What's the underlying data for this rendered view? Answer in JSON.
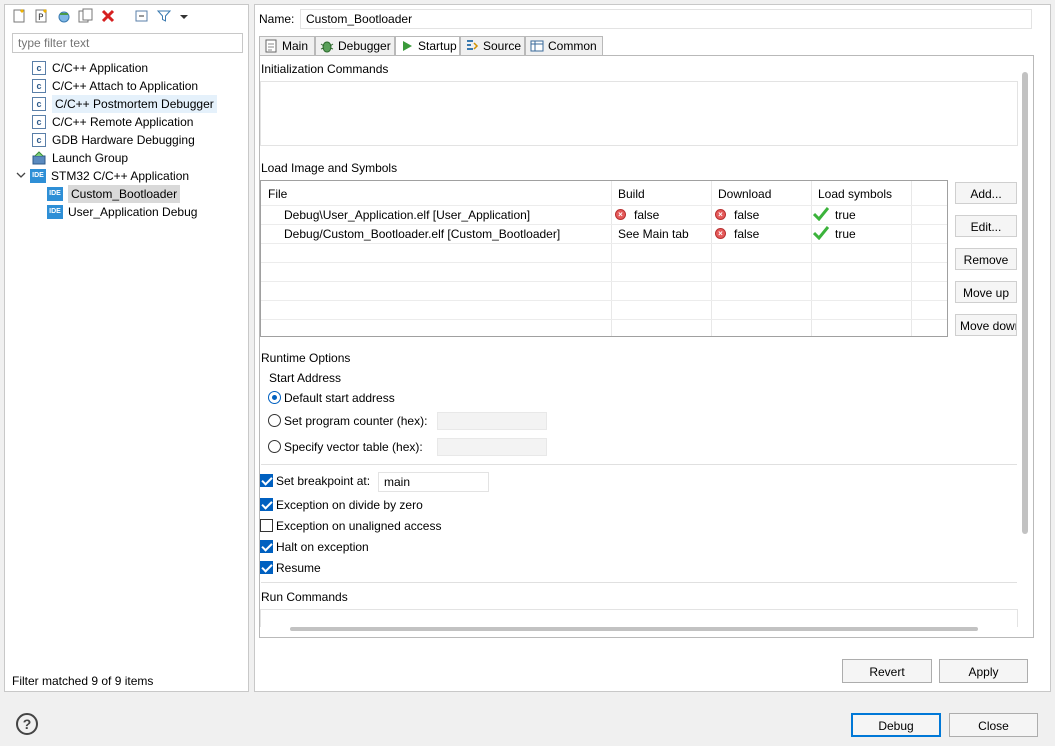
{
  "left_toolbar": {
    "icons": [
      "new-config-icon",
      "new-prototype-icon",
      "export-icon",
      "duplicate-icon",
      "delete-icon",
      "collapse-all-icon",
      "filter-icon",
      "dropdown-arrow-icon"
    ]
  },
  "filter": {
    "placeholder": "type filter text"
  },
  "tree": {
    "items": [
      {
        "label": "C/C++ Application",
        "icon": "c-app-icon"
      },
      {
        "label": "C/C++ Attach to Application",
        "icon": "c-app-icon"
      },
      {
        "label": "C/C++ Postmortem Debugger",
        "icon": "c-app-icon"
      },
      {
        "label": "C/C++ Remote Application",
        "icon": "c-app-icon"
      },
      {
        "label": "GDB Hardware Debugging",
        "icon": "c-app-icon"
      },
      {
        "label": "Launch Group",
        "icon": "launch-group-icon"
      },
      {
        "label": "STM32 C/C++ Application",
        "icon": "ide-icon",
        "expanded": true
      },
      {
        "label": "Custom_Bootloader",
        "icon": "ide-icon",
        "selected": true
      },
      {
        "label": "User_Application Debug",
        "icon": "ide-icon"
      }
    ],
    "ide_badge": "IDE",
    "c_badge": "c"
  },
  "filter_status": "Filter matched 9 of 9 items",
  "name": {
    "label": "Name:",
    "value": "Custom_Bootloader"
  },
  "tabs": [
    {
      "label": "Main",
      "icon": "page-icon"
    },
    {
      "label": "Debugger",
      "icon": "bug-icon"
    },
    {
      "label": "Startup",
      "icon": "play-icon",
      "active": true
    },
    {
      "label": "Source",
      "icon": "source-icon"
    },
    {
      "label": "Common",
      "icon": "table-icon"
    }
  ],
  "startup": {
    "init_commands_title": "Initialization Commands",
    "load_image_title": "Load Image and Symbols",
    "table": {
      "headers": [
        "File",
        "Build",
        "Download",
        "Load symbols"
      ],
      "rows": [
        {
          "file": "Debug\\User_Application.elf [User_Application]",
          "build": "false",
          "build_icon": "error-icon",
          "download": "false",
          "symbols": "true"
        },
        {
          "file": "Debug/Custom_Bootloader.elf [Custom_Bootloader]",
          "build": "See Main tab",
          "build_icon": "",
          "download": "false",
          "symbols": "true"
        }
      ]
    },
    "side_buttons": [
      "Add...",
      "Edit...",
      "Remove",
      "Move up",
      "Move down"
    ],
    "runtime_title": "Runtime Options",
    "start_address_title": "Start Address",
    "radios": [
      {
        "label": "Default start address",
        "checked": true
      },
      {
        "label": "Set program counter (hex):",
        "checked": false
      },
      {
        "label": "Specify vector table (hex):",
        "checked": false
      }
    ],
    "checks": [
      {
        "label": "Set breakpoint at:",
        "checked": true
      },
      {
        "label": "Exception on divide by zero",
        "checked": true
      },
      {
        "label": "Exception on unaligned access",
        "checked": false
      },
      {
        "label": "Halt on exception",
        "checked": true
      },
      {
        "label": "Resume",
        "checked": true
      }
    ],
    "breakpoint_value": "main",
    "run_commands_title": "Run Commands"
  },
  "buttons": {
    "revert": "Revert",
    "apply": "Apply",
    "debug": "Debug",
    "close": "Close",
    "help": "?"
  },
  "colors": {
    "accent": "#0060c0",
    "selected_bg": "#d9d9d9",
    "ide_blue": "#2e8fd6",
    "error_red": "#e55a5a",
    "check_green": "#3bb33b"
  }
}
